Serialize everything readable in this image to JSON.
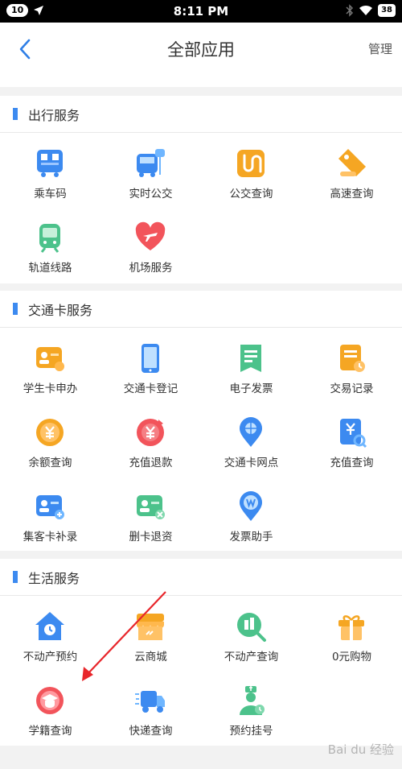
{
  "statusbar": {
    "notif_count": "10",
    "time": "8:11 PM",
    "battery": "38"
  },
  "nav": {
    "title": "全部应用",
    "manage": "管理"
  },
  "sections": [
    {
      "title": "出行服务",
      "items": [
        {
          "label": "乘车码",
          "icon": "bus-code-icon"
        },
        {
          "label": "实时公交",
          "icon": "realtime-bus-icon"
        },
        {
          "label": "公交查询",
          "icon": "bus-route-icon"
        },
        {
          "label": "高速查询",
          "icon": "highway-tag-icon"
        },
        {
          "label": "轨道线路",
          "icon": "metro-train-icon"
        },
        {
          "label": "机场服务",
          "icon": "airplane-heart-icon"
        }
      ]
    },
    {
      "title": "交通卡服务",
      "items": [
        {
          "label": "学生卡申办",
          "icon": "student-card-icon"
        },
        {
          "label": "交通卡登记",
          "icon": "card-register-icon"
        },
        {
          "label": "电子发票",
          "icon": "e-invoice-icon"
        },
        {
          "label": "交易记录",
          "icon": "transaction-record-icon"
        },
        {
          "label": "余额查询",
          "icon": "balance-coin-icon"
        },
        {
          "label": "充值退款",
          "icon": "refund-icon"
        },
        {
          "label": "交通卡网点",
          "icon": "location-pin-icon"
        },
        {
          "label": "充值查询",
          "icon": "recharge-search-icon"
        },
        {
          "label": "集客卡补录",
          "icon": "card-supplement-icon"
        },
        {
          "label": "删卡退资",
          "icon": "delete-card-icon"
        },
        {
          "label": "发票助手",
          "icon": "invoice-assistant-icon"
        }
      ]
    },
    {
      "title": "生活服务",
      "items": [
        {
          "label": "不动产预约",
          "icon": "house-clock-icon"
        },
        {
          "label": "云商城",
          "icon": "store-icon"
        },
        {
          "label": "不动产查询",
          "icon": "property-search-icon"
        },
        {
          "label": "0元购物",
          "icon": "gift-box-icon"
        },
        {
          "label": "学籍查询",
          "icon": "graduation-cap-icon"
        },
        {
          "label": "快递查询",
          "icon": "delivery-truck-icon"
        },
        {
          "label": "预约挂号",
          "icon": "doctor-icon"
        }
      ]
    }
  ],
  "watermark": "Bai du 经验"
}
